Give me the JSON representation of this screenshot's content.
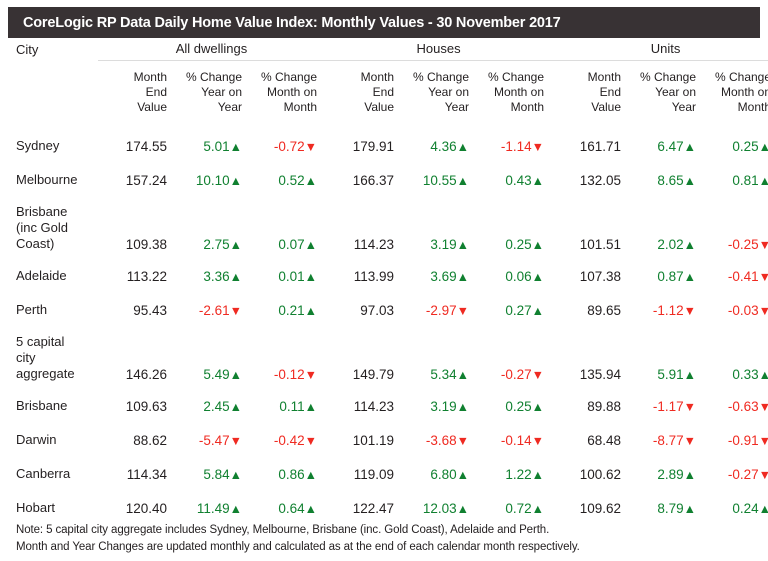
{
  "header": {
    "title": "CoreLogic RP Data Daily Home Value Index: Monthly Values - 30 November 2017",
    "bar_color": "#383234"
  },
  "colors": {
    "up": "#108030",
    "down": "#ef2a21",
    "text": "#231f20",
    "rule": "#dcdcdc"
  },
  "table": {
    "city_column_label": "City",
    "groups": [
      {
        "label": "All dwellings"
      },
      {
        "label": "Houses"
      },
      {
        "label": "Units"
      }
    ],
    "sub_headers": [
      "Month\nEnd\nValue",
      "% Change\nYear on\nYear",
      "% Change\nMonth on\nMonth"
    ],
    "icons": {
      "up": "▲",
      "down": "▼"
    },
    "rows": [
      {
        "city": "Sydney",
        "all_value": "174.55",
        "all_yoy": "5.01",
        "all_yoy_dir": "up",
        "all_mom": "-0.72",
        "all_mom_dir": "down",
        "hou_value": "179.91",
        "hou_yoy": "4.36",
        "hou_yoy_dir": "up",
        "hou_mom": "-1.14",
        "hou_mom_dir": "down",
        "uni_value": "161.71",
        "uni_yoy": "6.47",
        "uni_yoy_dir": "up",
        "uni_mom": "0.25",
        "uni_mom_dir": "up"
      },
      {
        "city": "Melbourne",
        "all_value": "157.24",
        "all_yoy": "10.10",
        "all_yoy_dir": "up",
        "all_mom": "0.52",
        "all_mom_dir": "up",
        "hou_value": "166.37",
        "hou_yoy": "10.55",
        "hou_yoy_dir": "up",
        "hou_mom": "0.43",
        "hou_mom_dir": "up",
        "uni_value": "132.05",
        "uni_yoy": "8.65",
        "uni_yoy_dir": "up",
        "uni_mom": "0.81",
        "uni_mom_dir": "up"
      },
      {
        "city": "Brisbane\n(inc Gold\nCoast)",
        "all_value": "109.38",
        "all_yoy": "2.75",
        "all_yoy_dir": "up",
        "all_mom": "0.07",
        "all_mom_dir": "up",
        "hou_value": "114.23",
        "hou_yoy": "3.19",
        "hou_yoy_dir": "up",
        "hou_mom": "0.25",
        "hou_mom_dir": "up",
        "uni_value": "101.51",
        "uni_yoy": "2.02",
        "uni_yoy_dir": "up",
        "uni_mom": "-0.25",
        "uni_mom_dir": "down"
      },
      {
        "city": "Adelaide",
        "all_value": "113.22",
        "all_yoy": "3.36",
        "all_yoy_dir": "up",
        "all_mom": "0.01",
        "all_mom_dir": "up",
        "hou_value": "113.99",
        "hou_yoy": "3.69",
        "hou_yoy_dir": "up",
        "hou_mom": "0.06",
        "hou_mom_dir": "up",
        "uni_value": "107.38",
        "uni_yoy": "0.87",
        "uni_yoy_dir": "up",
        "uni_mom": "-0.41",
        "uni_mom_dir": "down"
      },
      {
        "city": "Perth",
        "all_value": "95.43",
        "all_yoy": "-2.61",
        "all_yoy_dir": "down",
        "all_mom": "0.21",
        "all_mom_dir": "up",
        "hou_value": "97.03",
        "hou_yoy": "-2.97",
        "hou_yoy_dir": "down",
        "hou_mom": "0.27",
        "hou_mom_dir": "up",
        "uni_value": "89.65",
        "uni_yoy": "-1.12",
        "uni_yoy_dir": "down",
        "uni_mom": "-0.03",
        "uni_mom_dir": "down"
      },
      {
        "city": "5 capital\ncity\naggregate",
        "all_value": "146.26",
        "all_yoy": "5.49",
        "all_yoy_dir": "up",
        "all_mom": "-0.12",
        "all_mom_dir": "down",
        "hou_value": "149.79",
        "hou_yoy": "5.34",
        "hou_yoy_dir": "up",
        "hou_mom": "-0.27",
        "hou_mom_dir": "down",
        "uni_value": "135.94",
        "uni_yoy": "5.91",
        "uni_yoy_dir": "up",
        "uni_mom": "0.33",
        "uni_mom_dir": "up"
      },
      {
        "city": "Brisbane",
        "all_value": "109.63",
        "all_yoy": "2.45",
        "all_yoy_dir": "up",
        "all_mom": "0.11",
        "all_mom_dir": "up",
        "hou_value": "114.23",
        "hou_yoy": "3.19",
        "hou_yoy_dir": "up",
        "hou_mom": "0.25",
        "hou_mom_dir": "up",
        "uni_value": "89.88",
        "uni_yoy": "-1.17",
        "uni_yoy_dir": "down",
        "uni_mom": "-0.63",
        "uni_mom_dir": "down"
      },
      {
        "city": "Darwin",
        "all_value": "88.62",
        "all_yoy": "-5.47",
        "all_yoy_dir": "down",
        "all_mom": "-0.42",
        "all_mom_dir": "down",
        "hou_value": "101.19",
        "hou_yoy": "-3.68",
        "hou_yoy_dir": "down",
        "hou_mom": "-0.14",
        "hou_mom_dir": "down",
        "uni_value": "68.48",
        "uni_yoy": "-8.77",
        "uni_yoy_dir": "down",
        "uni_mom": "-0.91",
        "uni_mom_dir": "down"
      },
      {
        "city": "Canberra",
        "all_value": "114.34",
        "all_yoy": "5.84",
        "all_yoy_dir": "up",
        "all_mom": "0.86",
        "all_mom_dir": "up",
        "hou_value": "119.09",
        "hou_yoy": "6.80",
        "hou_yoy_dir": "up",
        "hou_mom": "1.22",
        "hou_mom_dir": "up",
        "uni_value": "100.62",
        "uni_yoy": "2.89",
        "uni_yoy_dir": "up",
        "uni_mom": "-0.27",
        "uni_mom_dir": "down"
      },
      {
        "city": "Hobart",
        "all_value": "120.40",
        "all_yoy": "11.49",
        "all_yoy_dir": "up",
        "all_mom": "0.64",
        "all_mom_dir": "up",
        "hou_value": "122.47",
        "hou_yoy": "12.03",
        "hou_yoy_dir": "up",
        "hou_mom": "0.72",
        "hou_mom_dir": "up",
        "uni_value": "109.62",
        "uni_yoy": "8.79",
        "uni_yoy_dir": "up",
        "uni_mom": "0.24",
        "uni_mom_dir": "up"
      }
    ]
  },
  "footnote": {
    "line1": "Note: 5 capital city aggregate includes Sydney, Melbourne, Brisbane (inc. Gold Coast), Adelaide and Perth.",
    "line2": "Month and Year Changes are updated monthly and calculated as at the end of each calendar month respectively."
  }
}
